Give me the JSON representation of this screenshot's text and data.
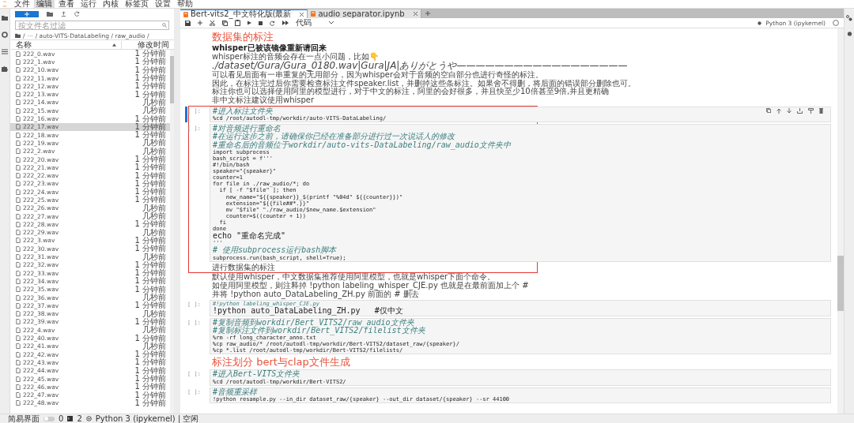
{
  "menu": [
    {
      "label": "文件",
      "selected": false
    },
    {
      "label": "编辑",
      "selected": true
    },
    {
      "label": "查看",
      "selected": false
    },
    {
      "label": "运行",
      "selected": false
    },
    {
      "label": "内核",
      "selected": false
    },
    {
      "label": "标签页",
      "selected": false
    },
    {
      "label": "设置",
      "selected": false
    },
    {
      "label": "帮助",
      "selected": false
    }
  ],
  "file_browser": {
    "filter": {
      "placeholder": "按文件名过滤"
    },
    "breadcrumb": [
      "/",
      "···",
      "/ auto-VITS-DataLabeling / raw_audio /"
    ],
    "columns": [
      "名称",
      "修改时间"
    ],
    "files": [
      {
        "name": "222_0.wav",
        "modified": "1 分钟前",
        "selected": false
      },
      {
        "name": "222_1.wav",
        "modified": "1 分钟前",
        "selected": false
      },
      {
        "name": "222_10.wav",
        "modified": "1 分钟前",
        "selected": false
      },
      {
        "name": "222_11.wav",
        "modified": "1 分钟前",
        "selected": false
      },
      {
        "name": "222_12.wav",
        "modified": "1 分钟前",
        "selected": false
      },
      {
        "name": "222_13.wav",
        "modified": "1 分钟前",
        "selected": false
      },
      {
        "name": "222_14.wav",
        "modified": "几秒前",
        "selected": false
      },
      {
        "name": "222_15.wav",
        "modified": "几秒前",
        "selected": false
      },
      {
        "name": "222_16.wav",
        "modified": "1 分钟前",
        "selected": false
      },
      {
        "name": "222_17.wav",
        "modified": "1 分钟前",
        "selected": true
      },
      {
        "name": "222_18.wav",
        "modified": "1 分钟前",
        "selected": false
      },
      {
        "name": "222_19.wav",
        "modified": "几秒前",
        "selected": false
      },
      {
        "name": "222_2.wav",
        "modified": "几秒前",
        "selected": false
      },
      {
        "name": "222_20.wav",
        "modified": "1 分钟前",
        "selected": false
      },
      {
        "name": "222_21.wav",
        "modified": "1 分钟前",
        "selected": false
      },
      {
        "name": "222_22.wav",
        "modified": "1 分钟前",
        "selected": false
      },
      {
        "name": "222_23.wav",
        "modified": "1 分钟前",
        "selected": false
      },
      {
        "name": "222_24.wav",
        "modified": "1 分钟前",
        "selected": false
      },
      {
        "name": "222_25.wav",
        "modified": "1 分钟前",
        "selected": false
      },
      {
        "name": "222_26.wav",
        "modified": "几秒前",
        "selected": false
      },
      {
        "name": "222_27.wav",
        "modified": "几秒前",
        "selected": false
      },
      {
        "name": "222_28.wav",
        "modified": "1 分钟前",
        "selected": false
      },
      {
        "name": "222_29.wav",
        "modified": "几秒前",
        "selected": false
      },
      {
        "name": "222_3.wav",
        "modified": "1 分钟前",
        "selected": false
      },
      {
        "name": "222_30.wav",
        "modified": "1 分钟前",
        "selected": false
      },
      {
        "name": "222_31.wav",
        "modified": "几秒前",
        "selected": false
      },
      {
        "name": "222_32.wav",
        "modified": "1 分钟前",
        "selected": false
      },
      {
        "name": "222_33.wav",
        "modified": "1 分钟前",
        "selected": false
      },
      {
        "name": "222_34.wav",
        "modified": "1 分钟前",
        "selected": false
      },
      {
        "name": "222_35.wav",
        "modified": "1 分钟前",
        "selected": false
      },
      {
        "name": "222_36.wav",
        "modified": "几秒前",
        "selected": false
      },
      {
        "name": "222_37.wav",
        "modified": "1 分钟前",
        "selected": false
      },
      {
        "name": "222_38.wav",
        "modified": "几秒前",
        "selected": false
      },
      {
        "name": "222_39.wav",
        "modified": "1 分钟前",
        "selected": false
      },
      {
        "name": "222_4.wav",
        "modified": "几秒前",
        "selected": false
      },
      {
        "name": "222_40.wav",
        "modified": "1 分钟前",
        "selected": false
      },
      {
        "name": "222_41.wav",
        "modified": "几秒前",
        "selected": false
      },
      {
        "name": "222_42.wav",
        "modified": "1 分钟前",
        "selected": false
      },
      {
        "name": "222_43.wav",
        "modified": "1 分钟前",
        "selected": false
      },
      {
        "name": "222_44.wav",
        "modified": "1 分钟前",
        "selected": false
      },
      {
        "name": "222_45.wav",
        "modified": "1 分钟前",
        "selected": false
      },
      {
        "name": "222_46.wav",
        "modified": "1 分钟前",
        "selected": false
      },
      {
        "name": "222_47.wav",
        "modified": "1 分钟前",
        "selected": false
      },
      {
        "name": "222_48.wav",
        "modified": "1 分钟前",
        "selected": false
      }
    ]
  },
  "status_bar": {
    "simple_mode": {
      "label": "简易界面",
      "on": false
    },
    "terminals": "0",
    "kernels": "2",
    "kernel_status": "Python 3 (ipykernel) | 空闲"
  },
  "tabs": [
    {
      "label": "Bert-vits2_中文特化版(最新",
      "selected": true
    },
    {
      "label": "audio separator.ipynb",
      "selected": false
    }
  ],
  "toolbar": {
    "cell_type": "代码",
    "kernel": "Python 3 (ipykernel)"
  },
  "cells": [
    {
      "kind": "heading",
      "text": "数据集的标注"
    },
    {
      "kind": "markdown",
      "lines": [
        {
          "kind": "bold",
          "text": "whisper已被该镜像重新请回来"
        },
        {
          "kind": "plain",
          "text": "whisper标注的音频会存在一点小问题，比如👇"
        },
        {
          "kind": "italic",
          "text": "./dataset/Gura/Gura_0180.wav|Gura|JA|ありがとうや——————————————————"
        },
        {
          "kind": "plain",
          "text": "可以看见后面有一串重复的无用部分，因为whisper会对于音频的空白部分也进行奇怪的标注。"
        },
        {
          "kind": "plain",
          "text": "因此，在标注完过后你需要检查标注文件speaker.list，并删掉这些条标注。如果舍不得删，将后面的错误部分删除也可。"
        },
        {
          "kind": "plain",
          "text": "标注你也可以选择使用阿里的模型进行，对于中文的标注，阿里的会好很多，并且快至少10倍甚至9倍,并且更精确"
        },
        {
          "kind": "plain",
          "text": "非中文标注建议使用whisper"
        }
      ]
    },
    {
      "kind": "highlight",
      "cells": [
        {
          "kind": "code",
          "selected": true,
          "prompt": "[ ]:",
          "lines": [
            {
              "kind": "cjk-comment",
              "text": "#进入标注文件夹"
            },
            {
              "kind": "code",
              "text": "%cd /root/autodl-tmp/workdir/auto-VITS-DataLabeling/"
            }
          ]
        },
        {
          "kind": "code",
          "selected": false,
          "prompt": "[ ]:",
          "lines": [
            {
              "kind": "cjk-comment",
              "text": "#对音频进行重命名"
            },
            {
              "kind": "cjk-comment",
              "text": "#在运行这步之前，请确保你已经在准备部分进行过一次说话人的修改"
            },
            {
              "kind": "cjk-comment",
              "text": "#重命名后的音频位于workdir/auto-vits-DataLabeling/raw_audio文件夹中"
            },
            {
              "kind": "code",
              "text": "import subprocess"
            },
            {
              "kind": "code",
              "text": "bash_script = f'''"
            },
            {
              "kind": "code",
              "text": "#!/bin/bash"
            },
            {
              "kind": "code",
              "text": "speaker=\"{speaker}\""
            },
            {
              "kind": "code",
              "text": "counter=1"
            },
            {
              "kind": "code",
              "text": "for file in ./raw_audio/*; do"
            },
            {
              "kind": "code",
              "text": "  if [ -f \"$file\" ]; then"
            },
            {
              "kind": "code",
              "text": "    new_name=\"${{speaker}}_$(printf \"%04d\" ${{counter}})\""
            },
            {
              "kind": "code",
              "text": "    extension=\"${{file##*.}}\""
            },
            {
              "kind": "code",
              "text": "    mv \"$file\" \"./raw_audio/$new_name.$extension\""
            },
            {
              "kind": "code",
              "text": "    counter=$((counter + 1))"
            },
            {
              "kind": "code",
              "text": "  fi"
            },
            {
              "kind": "code",
              "text": "done"
            },
            {
              "kind": "cjk-code",
              "text": "echo \"重命名完成\""
            },
            {
              "kind": "code",
              "text": "'''"
            },
            {
              "kind": "cjk-comment",
              "text": "# 使用subprocess运行bash脚本"
            },
            {
              "kind": "code",
              "text": "subprocess.run(bash_script, shell=True);"
            }
          ]
        },
        {
          "kind": "markdown",
          "lines": [
            {
              "kind": "plain",
              "text": "进行数据集的标注"
            }
          ]
        }
      ]
    },
    {
      "kind": "markdown",
      "lines": [
        {
          "kind": "plain",
          "text": "默认使用whisper，中文数据集推荐使用阿里模型，也就是whisper下面个命令。"
        },
        {
          "kind": "plain",
          "text": "如使用阿里模型，则注释掉 !python labeling_whisper_CJE.py 也就是在最前面加上个 #"
        },
        {
          "kind": "plain",
          "text": "并将 !python auto_DataLabeling_ZH.py 前面的 # 删去"
        }
      ]
    },
    {
      "kind": "code",
      "selected": false,
      "prompt": "[ ]:",
      "lines": [
        {
          "kind": "comment",
          "text": "#!python labeling_whisper_CJE.py"
        },
        {
          "kind": "cjk-code",
          "text": "!python auto_DataLabeling_ZH.py   #仅中文"
        }
      ]
    },
    {
      "kind": "code",
      "selected": false,
      "prompt": "[ ]:",
      "lines": [
        {
          "kind": "cjk-comment",
          "text": "#复制音频到workdir/Bert_VITS2/raw_audio文件夹"
        },
        {
          "kind": "cjk-comment",
          "text": "#复制标注文件到workdir/Bert_VITS2/filelist文件夹"
        },
        {
          "kind": "code",
          "text": "%rm -rf long_character_anno.txt"
        },
        {
          "kind": "code",
          "text": "%cp raw_audio/* /root/autodl-tmp/workdir/Bert-VITS2/dataset_raw/{speaker}/"
        },
        {
          "kind": "code",
          "text": "%cp *.list /root/autodl-tmp/workdir/Bert-VITS2/filelists/"
        }
      ]
    },
    {
      "kind": "heading",
      "text": "标注划分 bert与clap文件生成"
    },
    {
      "kind": "code",
      "selected": false,
      "prompt": "[ ]:",
      "lines": [
        {
          "kind": "cjk-comment",
          "text": "#进入Bert-VITS文件夹"
        },
        {
          "kind": "code",
          "text": "%cd /root/autodl-tmp/workdir/Bert-VITS2/"
        }
      ]
    },
    {
      "kind": "code",
      "selected": false,
      "prompt": "[ ]:",
      "lines": [
        {
          "kind": "cjk-comment",
          "text": "#音频重采样"
        },
        {
          "kind": "code",
          "text": "!python resample.py --in_dir dataset_raw/{speaker} --out_dir dataset/{speaker} --sr 44100"
        }
      ]
    }
  ]
}
